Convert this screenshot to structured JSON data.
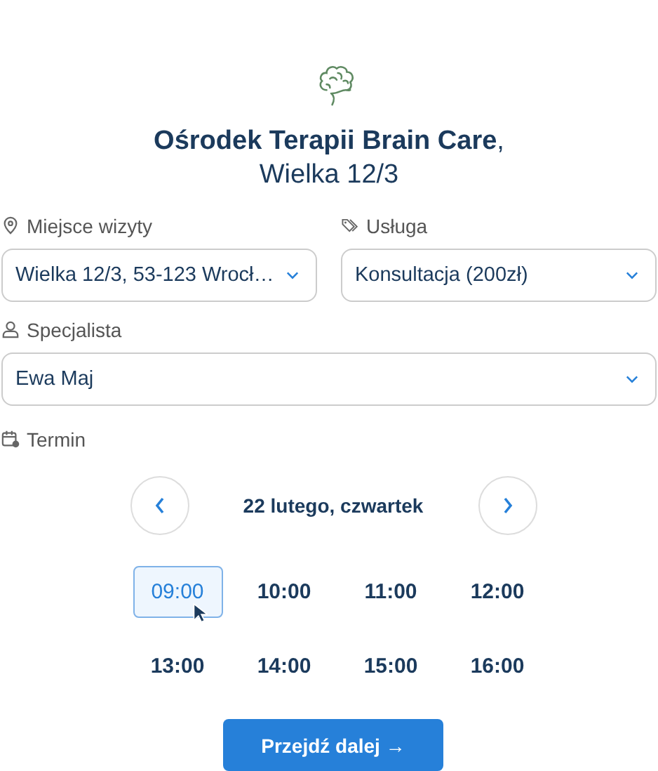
{
  "clinic": {
    "name": "Ośrodek Terapii Brain Care",
    "comma": ",",
    "address": "Wielka 12/3"
  },
  "fields": [
    {
      "kind": "location",
      "label": "Miejsce wizyty",
      "value": "Wielka 12/3, 53-123 Wrocł…"
    },
    {
      "kind": "service",
      "label": "Usługa",
      "value": "Konsultacja (200zł)"
    },
    {
      "kind": "person",
      "label": "Specjalista",
      "value": "Ewa Maj"
    }
  ],
  "term": {
    "label": "Termin",
    "date": "22 lutego, czwartek"
  },
  "slots": [
    {
      "time": "09:00",
      "selected": true
    },
    {
      "time": "10:00",
      "selected": false
    },
    {
      "time": "11:00",
      "selected": false
    },
    {
      "time": "12:00",
      "selected": false
    },
    {
      "time": "13:00",
      "selected": false
    },
    {
      "time": "14:00",
      "selected": false
    },
    {
      "time": "15:00",
      "selected": false
    },
    {
      "time": "16:00",
      "selected": false
    }
  ],
  "submit": "Przejdź dalej →"
}
